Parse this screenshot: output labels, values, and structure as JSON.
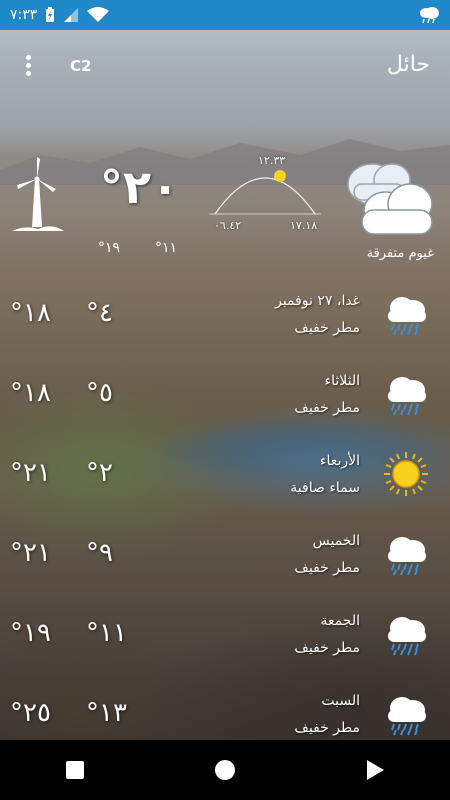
{
  "status_bar": {
    "time": "٧:٣٣",
    "bg_color": "#1e88c8",
    "icons": [
      "battery-charging-icon",
      "signal-icon",
      "wifi-icon",
      "cloud-rain-icon"
    ]
  },
  "header": {
    "city": "حائل",
    "unit_label": "C2",
    "menu_icon": "more-vert-icon"
  },
  "current": {
    "temperature": "°٢٠",
    "low": "°١١",
    "high": "°١٩",
    "condition": "غيوم متفرقة",
    "condition_icon": "cloud-icon",
    "wind_icon": "windmill-icon",
    "sun": {
      "noon": "١٢.٣٣",
      "sunrise": "٠٦.٤٢",
      "sunset": "١٧.١٨"
    }
  },
  "forecast": [
    {
      "day": "غدا، ٢٧ نوفمبر",
      "condition": "مطر خفيف",
      "low": "°٤",
      "high": "°١٨",
      "icon": "rain-icon"
    },
    {
      "day": "الثلاثاء",
      "condition": "مطر خفيف",
      "low": "°٥",
      "high": "°١٨",
      "icon": "rain-icon"
    },
    {
      "day": "الأربعاء",
      "condition": "سماء صافية",
      "low": "°٢",
      "high": "°٢١",
      "icon": "sun-icon"
    },
    {
      "day": "الخميس",
      "condition": "مطر خفيف",
      "low": "°٩",
      "high": "°٢١",
      "icon": "rain-icon"
    },
    {
      "day": "الجمعة",
      "condition": "مطر خفيف",
      "low": "°١١",
      "high": "°١٩",
      "icon": "rain-icon"
    },
    {
      "day": "السبت",
      "condition": "مطر خفيف",
      "low": "°١٣",
      "high": "°٢٥",
      "icon": "rain-icon"
    }
  ],
  "nav": {
    "recents": "square-icon",
    "home": "circle-icon",
    "back": "triangle-icon"
  }
}
